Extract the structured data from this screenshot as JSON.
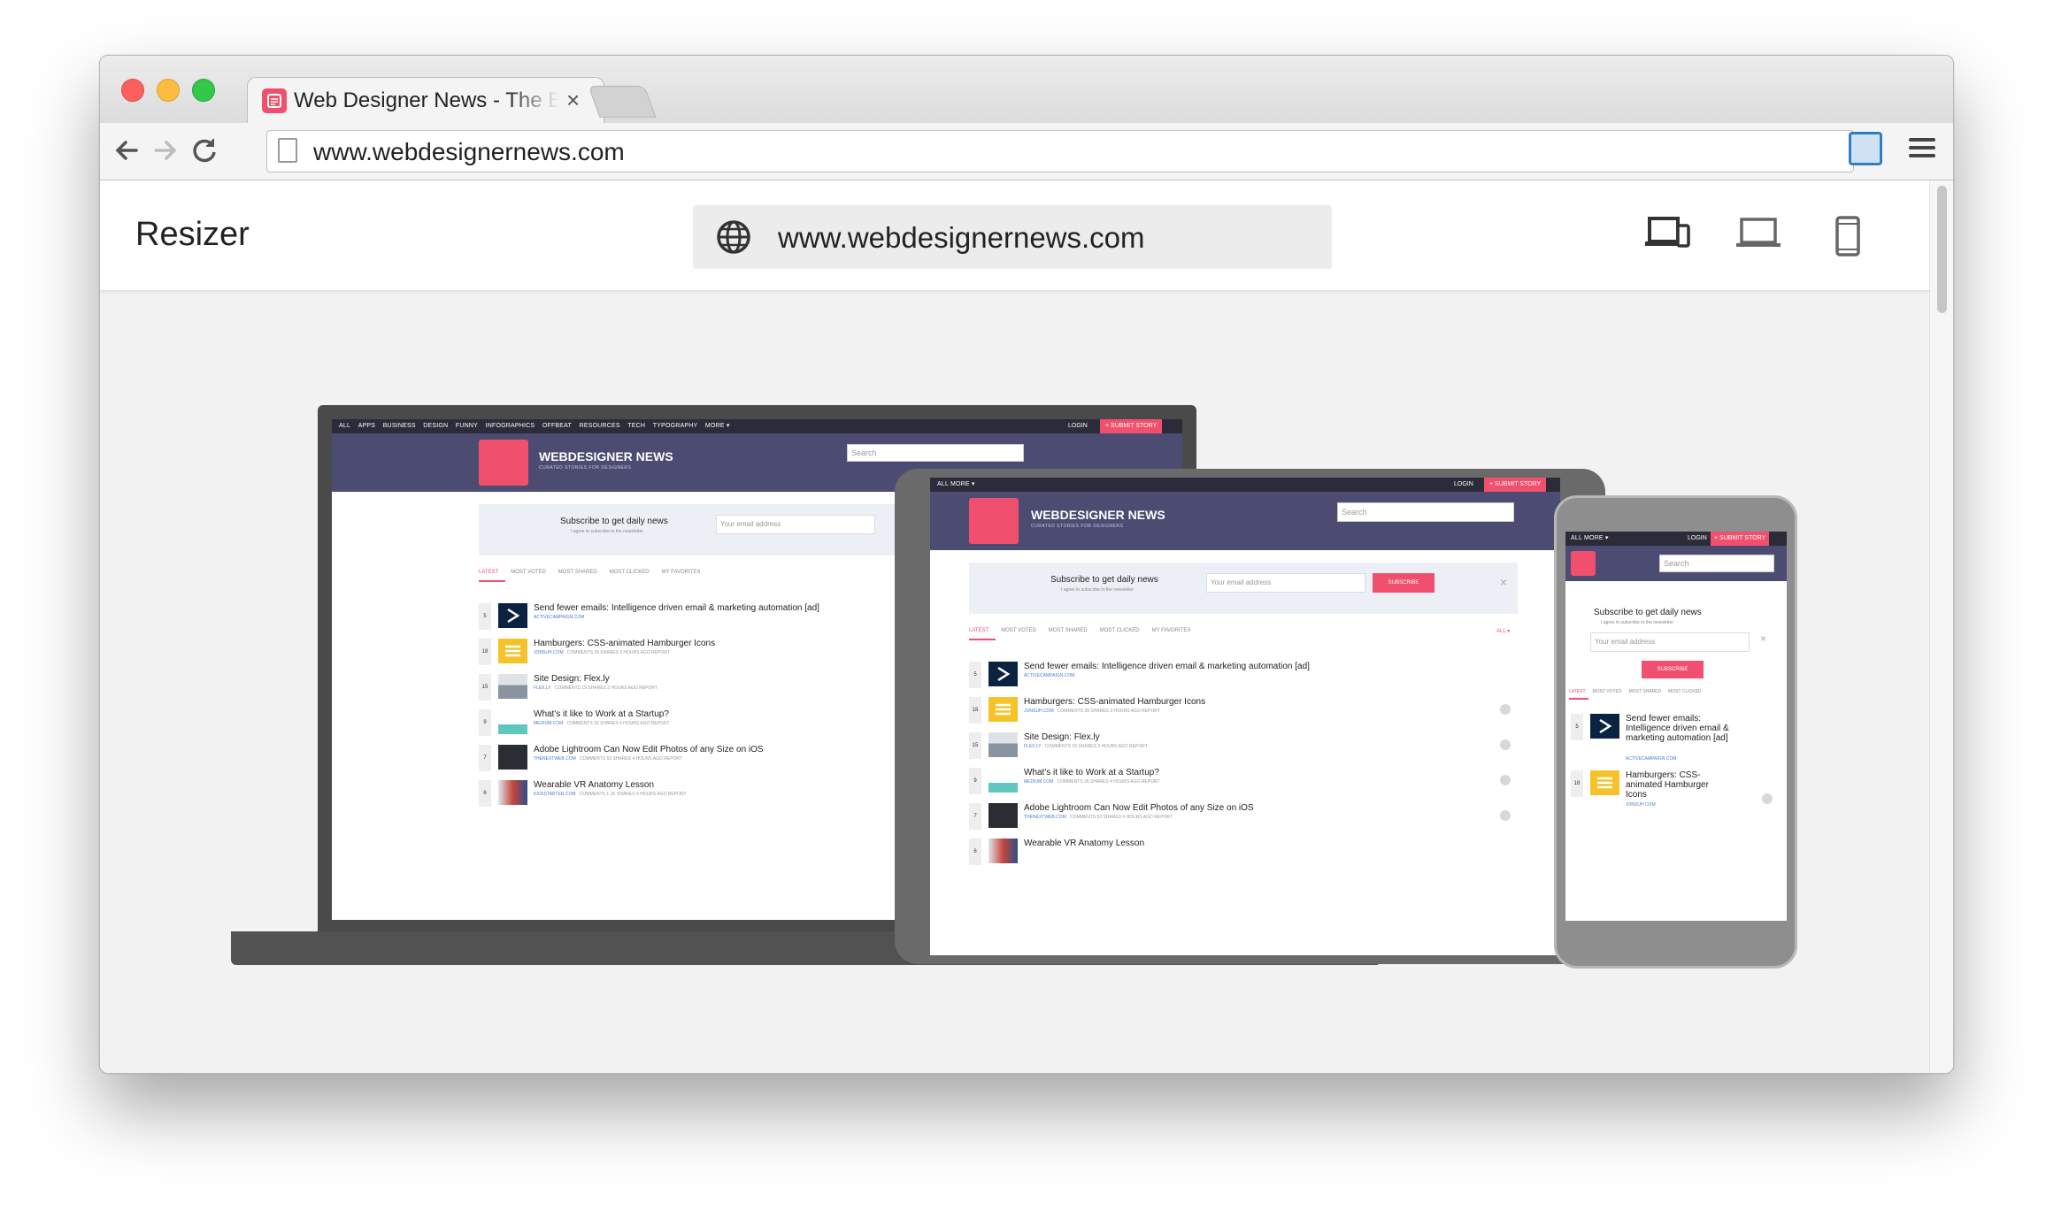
{
  "browser": {
    "tab_title": "Web Designer News - The Best Curated",
    "tab_close": "×",
    "address": "www.webdesignernews.com"
  },
  "resizer": {
    "title": "Resizer",
    "url": "www.webdesignernews.com",
    "device_buttons": [
      "responsive-icon",
      "laptop-icon",
      "phone-icon"
    ]
  },
  "site": {
    "nav_items": [
      "ALL",
      "APPS",
      "BUSINESS",
      "DESIGN",
      "FUNNY",
      "INFOGRAPHICS",
      "OFFBEAT",
      "RESOURCES",
      "TECH",
      "TYPOGRAPHY",
      "MORE ▾"
    ],
    "nav_short": "ALL    MORE ▾",
    "login": "LOGIN",
    "submit": "+ SUBMIT STORY",
    "brand": "WEBDESIGNER NEWS",
    "tagline": "CURATED STORIES FOR DESIGNERS",
    "search_placeholder": "Search",
    "subscribe_title": "Subscribe to get daily news",
    "subscribe_note": "I agree to subscribe to the newsletter",
    "email_placeholder": "Your email address",
    "subscribe_button": "SUBSCRIBE",
    "tabs": [
      "LATEST",
      "MOST VOTED",
      "MOST SHARED",
      "MOST CLICKED",
      "MY FAVORITES"
    ],
    "filter_all": "ALL ▾",
    "close": "×",
    "stories": [
      {
        "votes": "5",
        "title": "Send fewer emails: Intelligence driven email & marketing automation [ad]",
        "source": "ACTIVECAMPAIGN.COM",
        "meta": ""
      },
      {
        "votes": "18",
        "title": "Hamburgers: CSS-animated Hamburger Icons",
        "source": "JONSUH.COM",
        "meta": "COMMENTS   39 SHARES   3 HOURS AGO   REPORT"
      },
      {
        "votes": "15",
        "title": "Site Design: Flex.ly",
        "source": "FLEX.LY",
        "meta": "COMMENTS   19 SHARES   3 HOURS AGO   REPORT"
      },
      {
        "votes": "9",
        "title": "What's it like to Work at a Startup?",
        "source": "MEDIUM.COM",
        "meta": "COMMENTS   26 SHARES   4 HOURS AGO   REPORT"
      },
      {
        "votes": "7",
        "title": "Adobe Lightroom Can Now Edit Photos of any Size on iOS",
        "source": "THENEXTWEB.COM",
        "meta": "COMMENTS   53 SHARES   4 HOURS AGO   REPORT"
      },
      {
        "votes": "6",
        "title": "Wearable VR Anatomy Lesson",
        "source": "KICKSTARTER.COM",
        "meta": "COMMENTS   1.1K SHARES   4 HOURS AGO   REPORT"
      }
    ]
  },
  "colors": {
    "brand_red": "#f0506e",
    "header_purple": "#4c4c72",
    "nav_dark": "#2b2b3a"
  }
}
